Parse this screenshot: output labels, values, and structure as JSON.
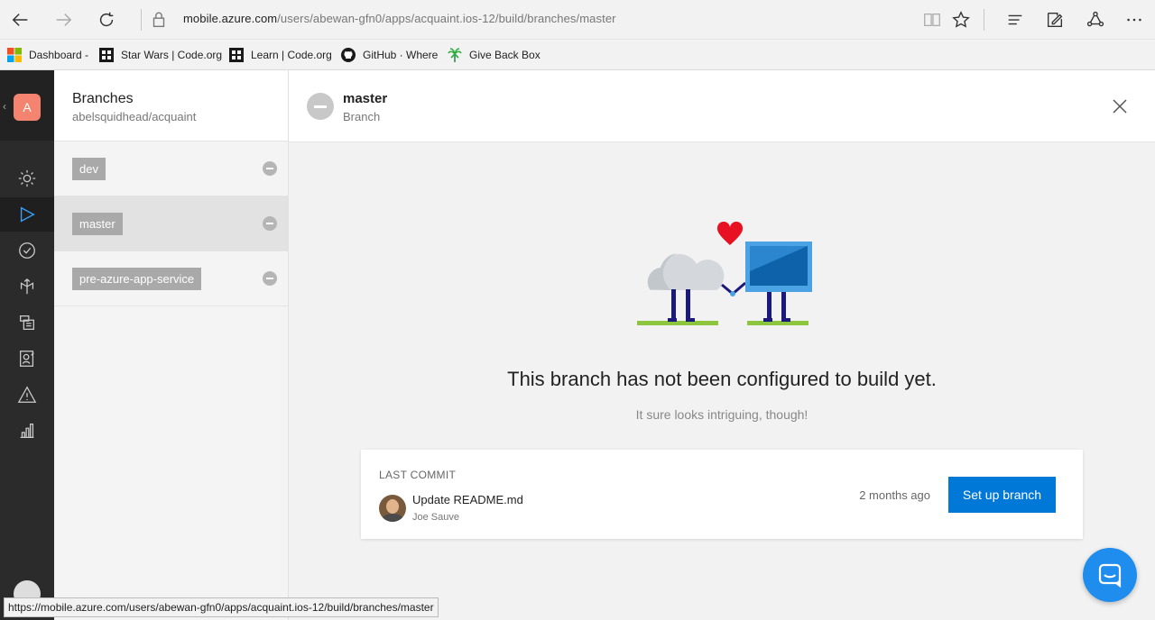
{
  "browser": {
    "address_host": "mobile.azure.com",
    "address_path": "/users/abewan-gfn0/apps/acquaint.ios-12/build/branches/master",
    "favorites": [
      {
        "label": "Dashboard -",
        "icon": "windows-logo-icon"
      },
      {
        "label": "Star Wars | Code.org",
        "icon": "code-org-icon"
      },
      {
        "label": "Learn | Code.org",
        "icon": "code-org-icon"
      },
      {
        "label": "GitHub · Where",
        "icon": "github-icon"
      },
      {
        "label": "Give Back Box",
        "icon": "palm-tree-icon"
      }
    ],
    "status_url": "https://mobile.azure.com/users/abewan-gfn0/apps/acquaint.ios-12/build/branches/master"
  },
  "app": {
    "avatar_letter": "A",
    "accent": "#0078d7"
  },
  "branches_panel": {
    "title": "Branches",
    "repo": "abelsquidhead/acquaint",
    "items": [
      {
        "name": "dev",
        "selected": false
      },
      {
        "name": "master",
        "selected": true
      },
      {
        "name": "pre-azure-app-service",
        "selected": false
      }
    ]
  },
  "detail": {
    "title": "master",
    "subtitle": "Branch",
    "headline": "This branch has not been configured to build yet.",
    "subline": "It sure looks intriguing, though!",
    "last_commit": {
      "label": "LAST COMMIT",
      "message": "Update README.md",
      "author": "Joe Sauve",
      "time": "2 months ago"
    },
    "setup_button": "Set up branch"
  }
}
